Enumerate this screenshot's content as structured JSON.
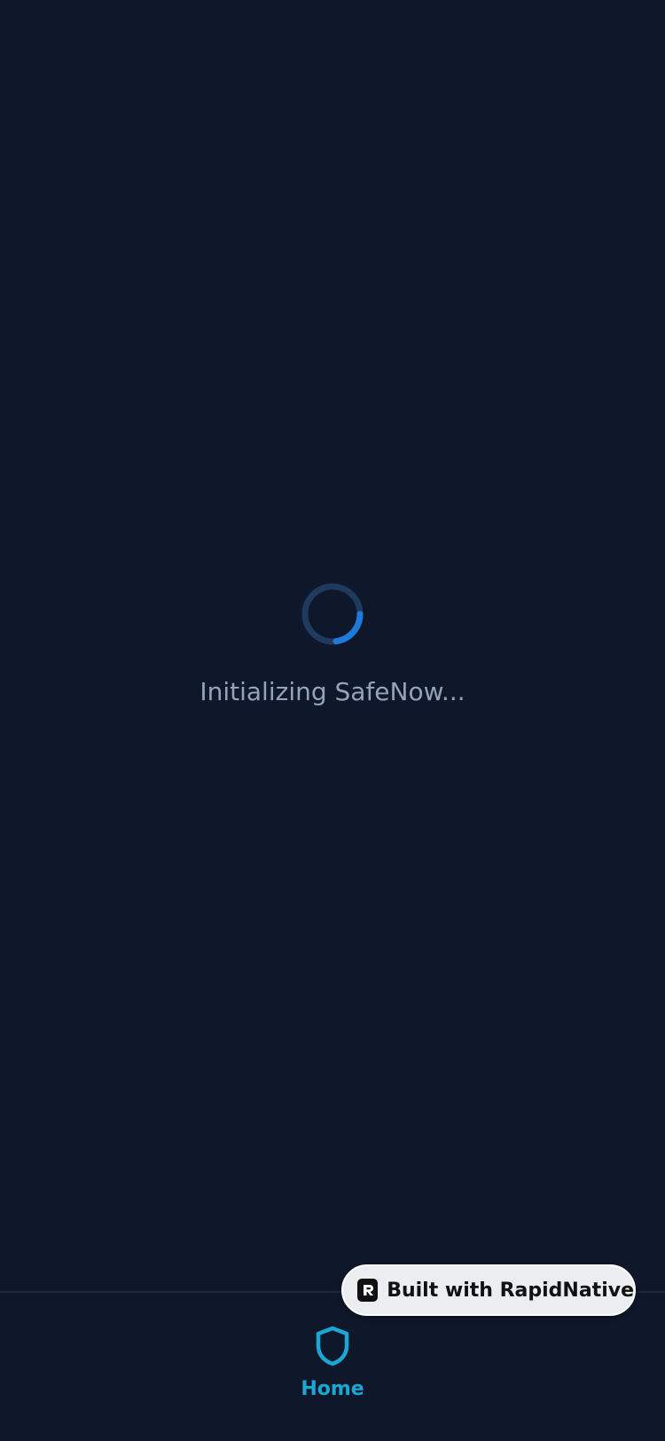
{
  "loading": {
    "message": "Initializing SafeNow..."
  },
  "tab_bar": {
    "home": {
      "label": "Home",
      "icon": "shield-icon"
    }
  },
  "badge": {
    "label": "Built with RapidNative",
    "icon": "rapidnative-logo-icon"
  },
  "colors": {
    "background": "#0f172a",
    "spinner_track": "#1e3a5f",
    "spinner_arc": "#1e7ad8",
    "loading_text": "#94a3b8",
    "tab_active": "#1ba7d4",
    "badge_background": "#ebedf0"
  }
}
